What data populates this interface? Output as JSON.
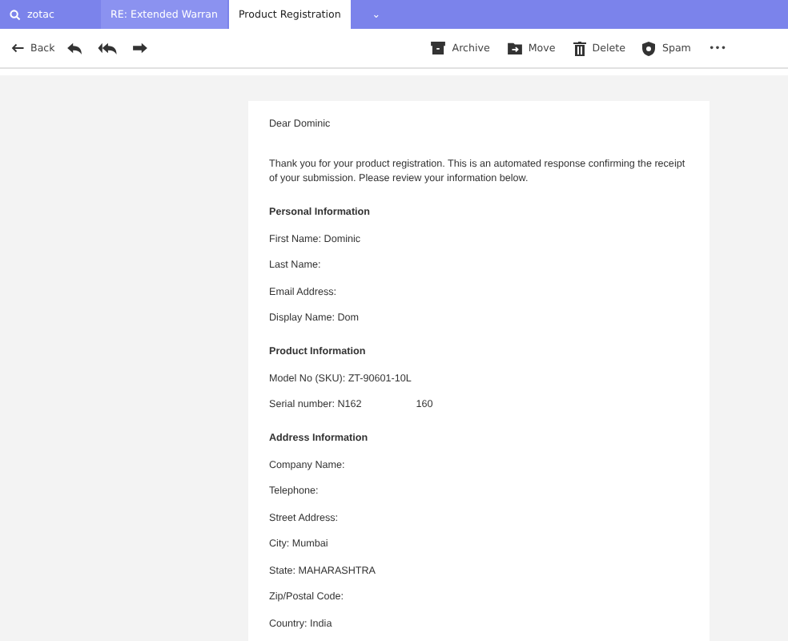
{
  "tabs": [
    {
      "kind": "search",
      "label": "zotac",
      "selected": false
    },
    {
      "kind": "tab",
      "label": "RE: Extended Warran",
      "selected": false
    },
    {
      "kind": "tab",
      "label": "Product Registration",
      "selected": true
    },
    {
      "kind": "more",
      "label": "⌄",
      "selected": false
    }
  ],
  "toolbar": {
    "back": "Back",
    "actions": [
      {
        "kind": "archive",
        "label": "Archive"
      },
      {
        "kind": "move",
        "label": "Move"
      },
      {
        "kind": "delete",
        "label": "Delete"
      },
      {
        "kind": "spam",
        "label": "Spam"
      }
    ],
    "more": "•••"
  },
  "email": {
    "greeting": "Dear Dominic",
    "intro": "Thank you for your product registration. This is an automated response confirming the receipt of your submission. Please review your information below.",
    "sections": [
      {
        "heading": "Personal Information",
        "lines": [
          {
            "text": "First Name: Dominic"
          },
          {
            "text": "Last Name:"
          },
          {
            "text": "Email Address:"
          },
          {
            "text": "Display Name: Dom"
          }
        ]
      },
      {
        "heading": "Product Information",
        "lines": [
          {
            "text": "Model No (SKU): ZT-90601-10L"
          },
          {
            "text": "Serial number: N162",
            "extra": "160"
          }
        ]
      },
      {
        "heading": "Address Information",
        "lines": [
          {
            "text": "Company Name:"
          },
          {
            "text": "Telephone:"
          },
          {
            "text": "Street Address:"
          },
          {
            "text": "City: Mumbai"
          },
          {
            "text": "State: MAHARASHTRA"
          },
          {
            "text": "Zip/Postal Code:"
          },
          {
            "text": "Country: India"
          }
        ]
      }
    ]
  }
}
